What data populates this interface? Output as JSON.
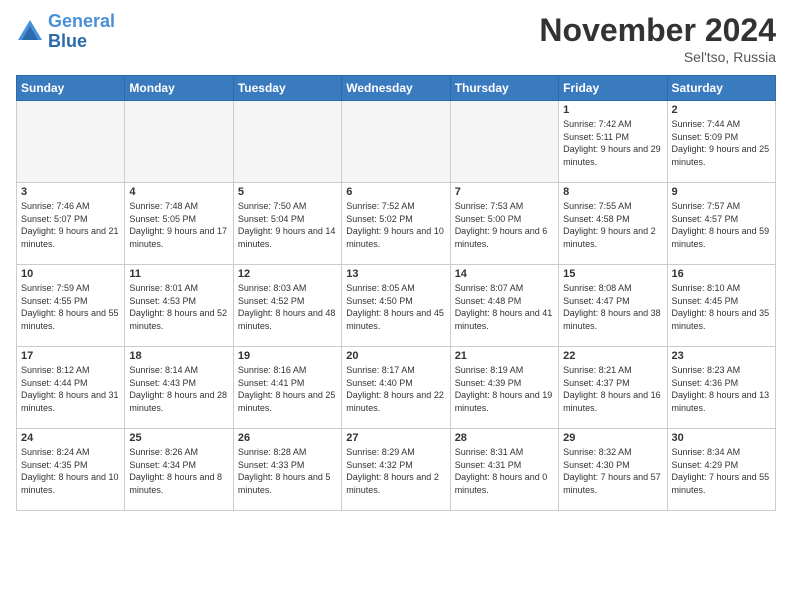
{
  "header": {
    "logo_line1": "General",
    "logo_line2": "Blue",
    "month": "November 2024",
    "location": "Sel'tso, Russia"
  },
  "days_of_week": [
    "Sunday",
    "Monday",
    "Tuesday",
    "Wednesday",
    "Thursday",
    "Friday",
    "Saturday"
  ],
  "weeks": [
    [
      {
        "day": "",
        "info": ""
      },
      {
        "day": "",
        "info": ""
      },
      {
        "day": "",
        "info": ""
      },
      {
        "day": "",
        "info": ""
      },
      {
        "day": "",
        "info": ""
      },
      {
        "day": "1",
        "info": "Sunrise: 7:42 AM\nSunset: 5:11 PM\nDaylight: 9 hours and 29 minutes."
      },
      {
        "day": "2",
        "info": "Sunrise: 7:44 AM\nSunset: 5:09 PM\nDaylight: 9 hours and 25 minutes."
      }
    ],
    [
      {
        "day": "3",
        "info": "Sunrise: 7:46 AM\nSunset: 5:07 PM\nDaylight: 9 hours and 21 minutes."
      },
      {
        "day": "4",
        "info": "Sunrise: 7:48 AM\nSunset: 5:05 PM\nDaylight: 9 hours and 17 minutes."
      },
      {
        "day": "5",
        "info": "Sunrise: 7:50 AM\nSunset: 5:04 PM\nDaylight: 9 hours and 14 minutes."
      },
      {
        "day": "6",
        "info": "Sunrise: 7:52 AM\nSunset: 5:02 PM\nDaylight: 9 hours and 10 minutes."
      },
      {
        "day": "7",
        "info": "Sunrise: 7:53 AM\nSunset: 5:00 PM\nDaylight: 9 hours and 6 minutes."
      },
      {
        "day": "8",
        "info": "Sunrise: 7:55 AM\nSunset: 4:58 PM\nDaylight: 9 hours and 2 minutes."
      },
      {
        "day": "9",
        "info": "Sunrise: 7:57 AM\nSunset: 4:57 PM\nDaylight: 8 hours and 59 minutes."
      }
    ],
    [
      {
        "day": "10",
        "info": "Sunrise: 7:59 AM\nSunset: 4:55 PM\nDaylight: 8 hours and 55 minutes."
      },
      {
        "day": "11",
        "info": "Sunrise: 8:01 AM\nSunset: 4:53 PM\nDaylight: 8 hours and 52 minutes."
      },
      {
        "day": "12",
        "info": "Sunrise: 8:03 AM\nSunset: 4:52 PM\nDaylight: 8 hours and 48 minutes."
      },
      {
        "day": "13",
        "info": "Sunrise: 8:05 AM\nSunset: 4:50 PM\nDaylight: 8 hours and 45 minutes."
      },
      {
        "day": "14",
        "info": "Sunrise: 8:07 AM\nSunset: 4:48 PM\nDaylight: 8 hours and 41 minutes."
      },
      {
        "day": "15",
        "info": "Sunrise: 8:08 AM\nSunset: 4:47 PM\nDaylight: 8 hours and 38 minutes."
      },
      {
        "day": "16",
        "info": "Sunrise: 8:10 AM\nSunset: 4:45 PM\nDaylight: 8 hours and 35 minutes."
      }
    ],
    [
      {
        "day": "17",
        "info": "Sunrise: 8:12 AM\nSunset: 4:44 PM\nDaylight: 8 hours and 31 minutes."
      },
      {
        "day": "18",
        "info": "Sunrise: 8:14 AM\nSunset: 4:43 PM\nDaylight: 8 hours and 28 minutes."
      },
      {
        "day": "19",
        "info": "Sunrise: 8:16 AM\nSunset: 4:41 PM\nDaylight: 8 hours and 25 minutes."
      },
      {
        "day": "20",
        "info": "Sunrise: 8:17 AM\nSunset: 4:40 PM\nDaylight: 8 hours and 22 minutes."
      },
      {
        "day": "21",
        "info": "Sunrise: 8:19 AM\nSunset: 4:39 PM\nDaylight: 8 hours and 19 minutes."
      },
      {
        "day": "22",
        "info": "Sunrise: 8:21 AM\nSunset: 4:37 PM\nDaylight: 8 hours and 16 minutes."
      },
      {
        "day": "23",
        "info": "Sunrise: 8:23 AM\nSunset: 4:36 PM\nDaylight: 8 hours and 13 minutes."
      }
    ],
    [
      {
        "day": "24",
        "info": "Sunrise: 8:24 AM\nSunset: 4:35 PM\nDaylight: 8 hours and 10 minutes."
      },
      {
        "day": "25",
        "info": "Sunrise: 8:26 AM\nSunset: 4:34 PM\nDaylight: 8 hours and 8 minutes."
      },
      {
        "day": "26",
        "info": "Sunrise: 8:28 AM\nSunset: 4:33 PM\nDaylight: 8 hours and 5 minutes."
      },
      {
        "day": "27",
        "info": "Sunrise: 8:29 AM\nSunset: 4:32 PM\nDaylight: 8 hours and 2 minutes."
      },
      {
        "day": "28",
        "info": "Sunrise: 8:31 AM\nSunset: 4:31 PM\nDaylight: 8 hours and 0 minutes."
      },
      {
        "day": "29",
        "info": "Sunrise: 8:32 AM\nSunset: 4:30 PM\nDaylight: 7 hours and 57 minutes."
      },
      {
        "day": "30",
        "info": "Sunrise: 8:34 AM\nSunset: 4:29 PM\nDaylight: 7 hours and 55 minutes."
      }
    ]
  ]
}
